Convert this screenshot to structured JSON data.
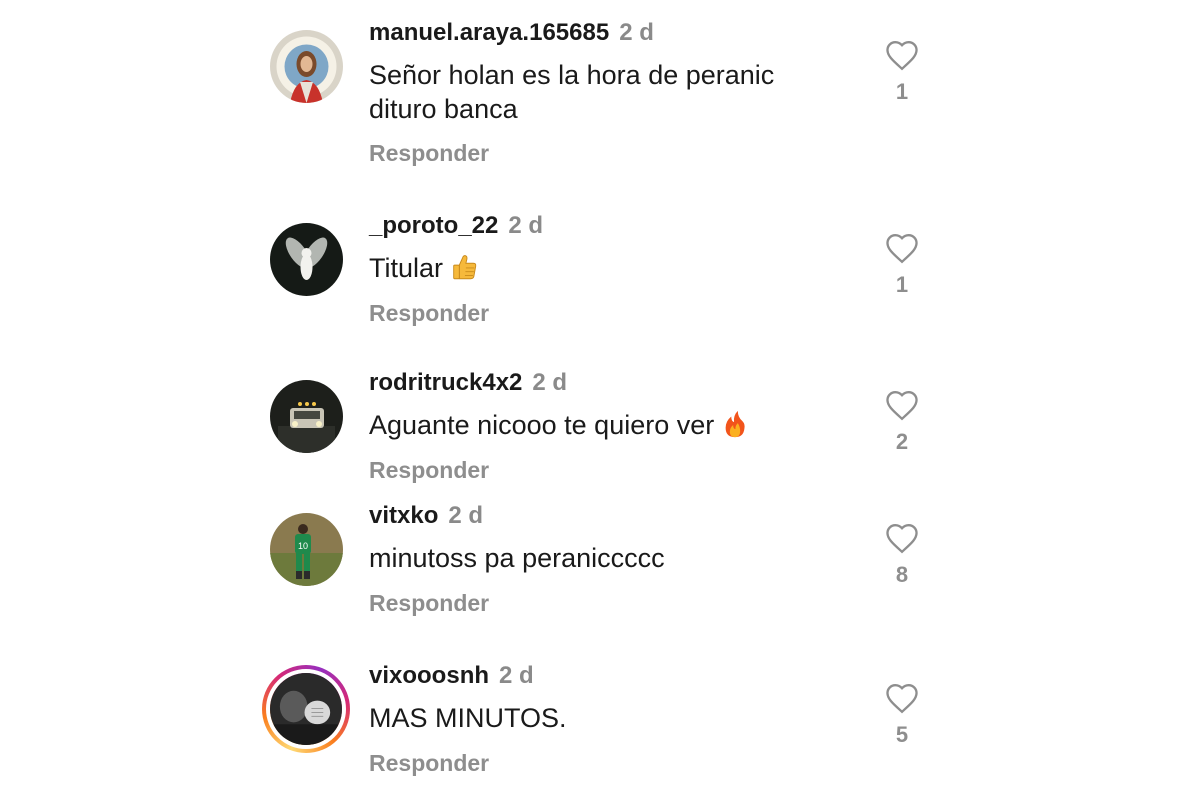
{
  "comments": [
    {
      "username": "manuel.araya.165685",
      "time": "2 d",
      "text": "Señor holan es la hora de peranic dituro banca",
      "reply_label": "Responder",
      "likes": "1",
      "avatar": "jesus-portrait-avatar"
    },
    {
      "username": "_poroto_22",
      "time": "2 d",
      "text": "Titular",
      "emoji": "thumbs-up-emoji",
      "reply_label": "Responder",
      "likes": "1",
      "avatar": "fly-insect-avatar"
    },
    {
      "username": "rodritruck4x2",
      "time": "2 d",
      "text": "Aguante nicooo te quiero ver",
      "emoji": "fire-emoji",
      "reply_label": "Responder",
      "likes": "2",
      "avatar": "truck-night-avatar"
    },
    {
      "username": "vitxko",
      "time": "2 d",
      "text": "minutoss pa peraniccccc",
      "reply_label": "Responder",
      "likes": "8",
      "avatar": "soccer-player-avatar"
    },
    {
      "username": "vixooosnh",
      "time": "2 d",
      "text": "MAS MINUTOS.",
      "reply_label": "Responder",
      "likes": "5",
      "avatar": "bw-photo-avatar",
      "has_story_ring": true
    }
  ],
  "colors": {
    "text": "#1a1a1a",
    "muted": "#8e8e8e",
    "story_ring": [
      "#feda75",
      "#fa7e1e",
      "#d62976",
      "#962fbf"
    ]
  },
  "icons": {
    "like": "heart-outline-icon"
  }
}
